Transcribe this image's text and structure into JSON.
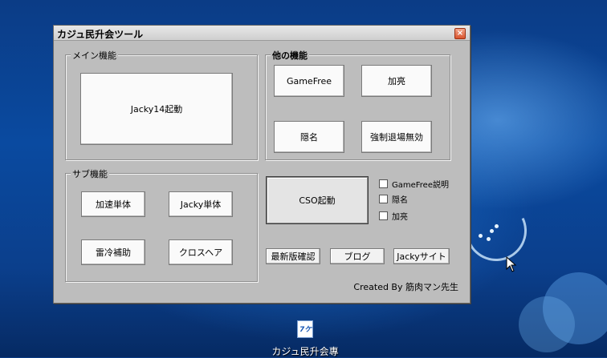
{
  "window": {
    "title": "カジュ民升会ツール",
    "close_glyph": "×"
  },
  "main_group": {
    "label": "メイン機能",
    "launch_button": "Jacky14起動"
  },
  "other_group": {
    "label": "他の機能",
    "buttons": [
      "GameFree",
      "加亮",
      "隠名",
      "強制退場無効"
    ]
  },
  "sub_group": {
    "label": "サブ機能",
    "buttons": [
      "加速単体",
      "Jacky単体",
      "雷冷補助",
      "クロスヘア"
    ]
  },
  "cso_button": "CSO起動",
  "checkboxes": [
    {
      "label": "GameFree説明",
      "checked": false
    },
    {
      "label": "隠名",
      "checked": false
    },
    {
      "label": "加亮",
      "checked": false
    }
  ],
  "bottom_buttons": [
    "最新版確認",
    "ブログ",
    "Jackyサイト"
  ],
  "credit": "Created By 筋肉マン先生",
  "desktop": {
    "icon_glyph": "7ケ",
    "icon_label": "カジュ民升会專"
  },
  "colors": {
    "desktop_bg": "#0a4aa0",
    "window_bg": "#bdbdbd",
    "close_button": "#d9532d"
  }
}
